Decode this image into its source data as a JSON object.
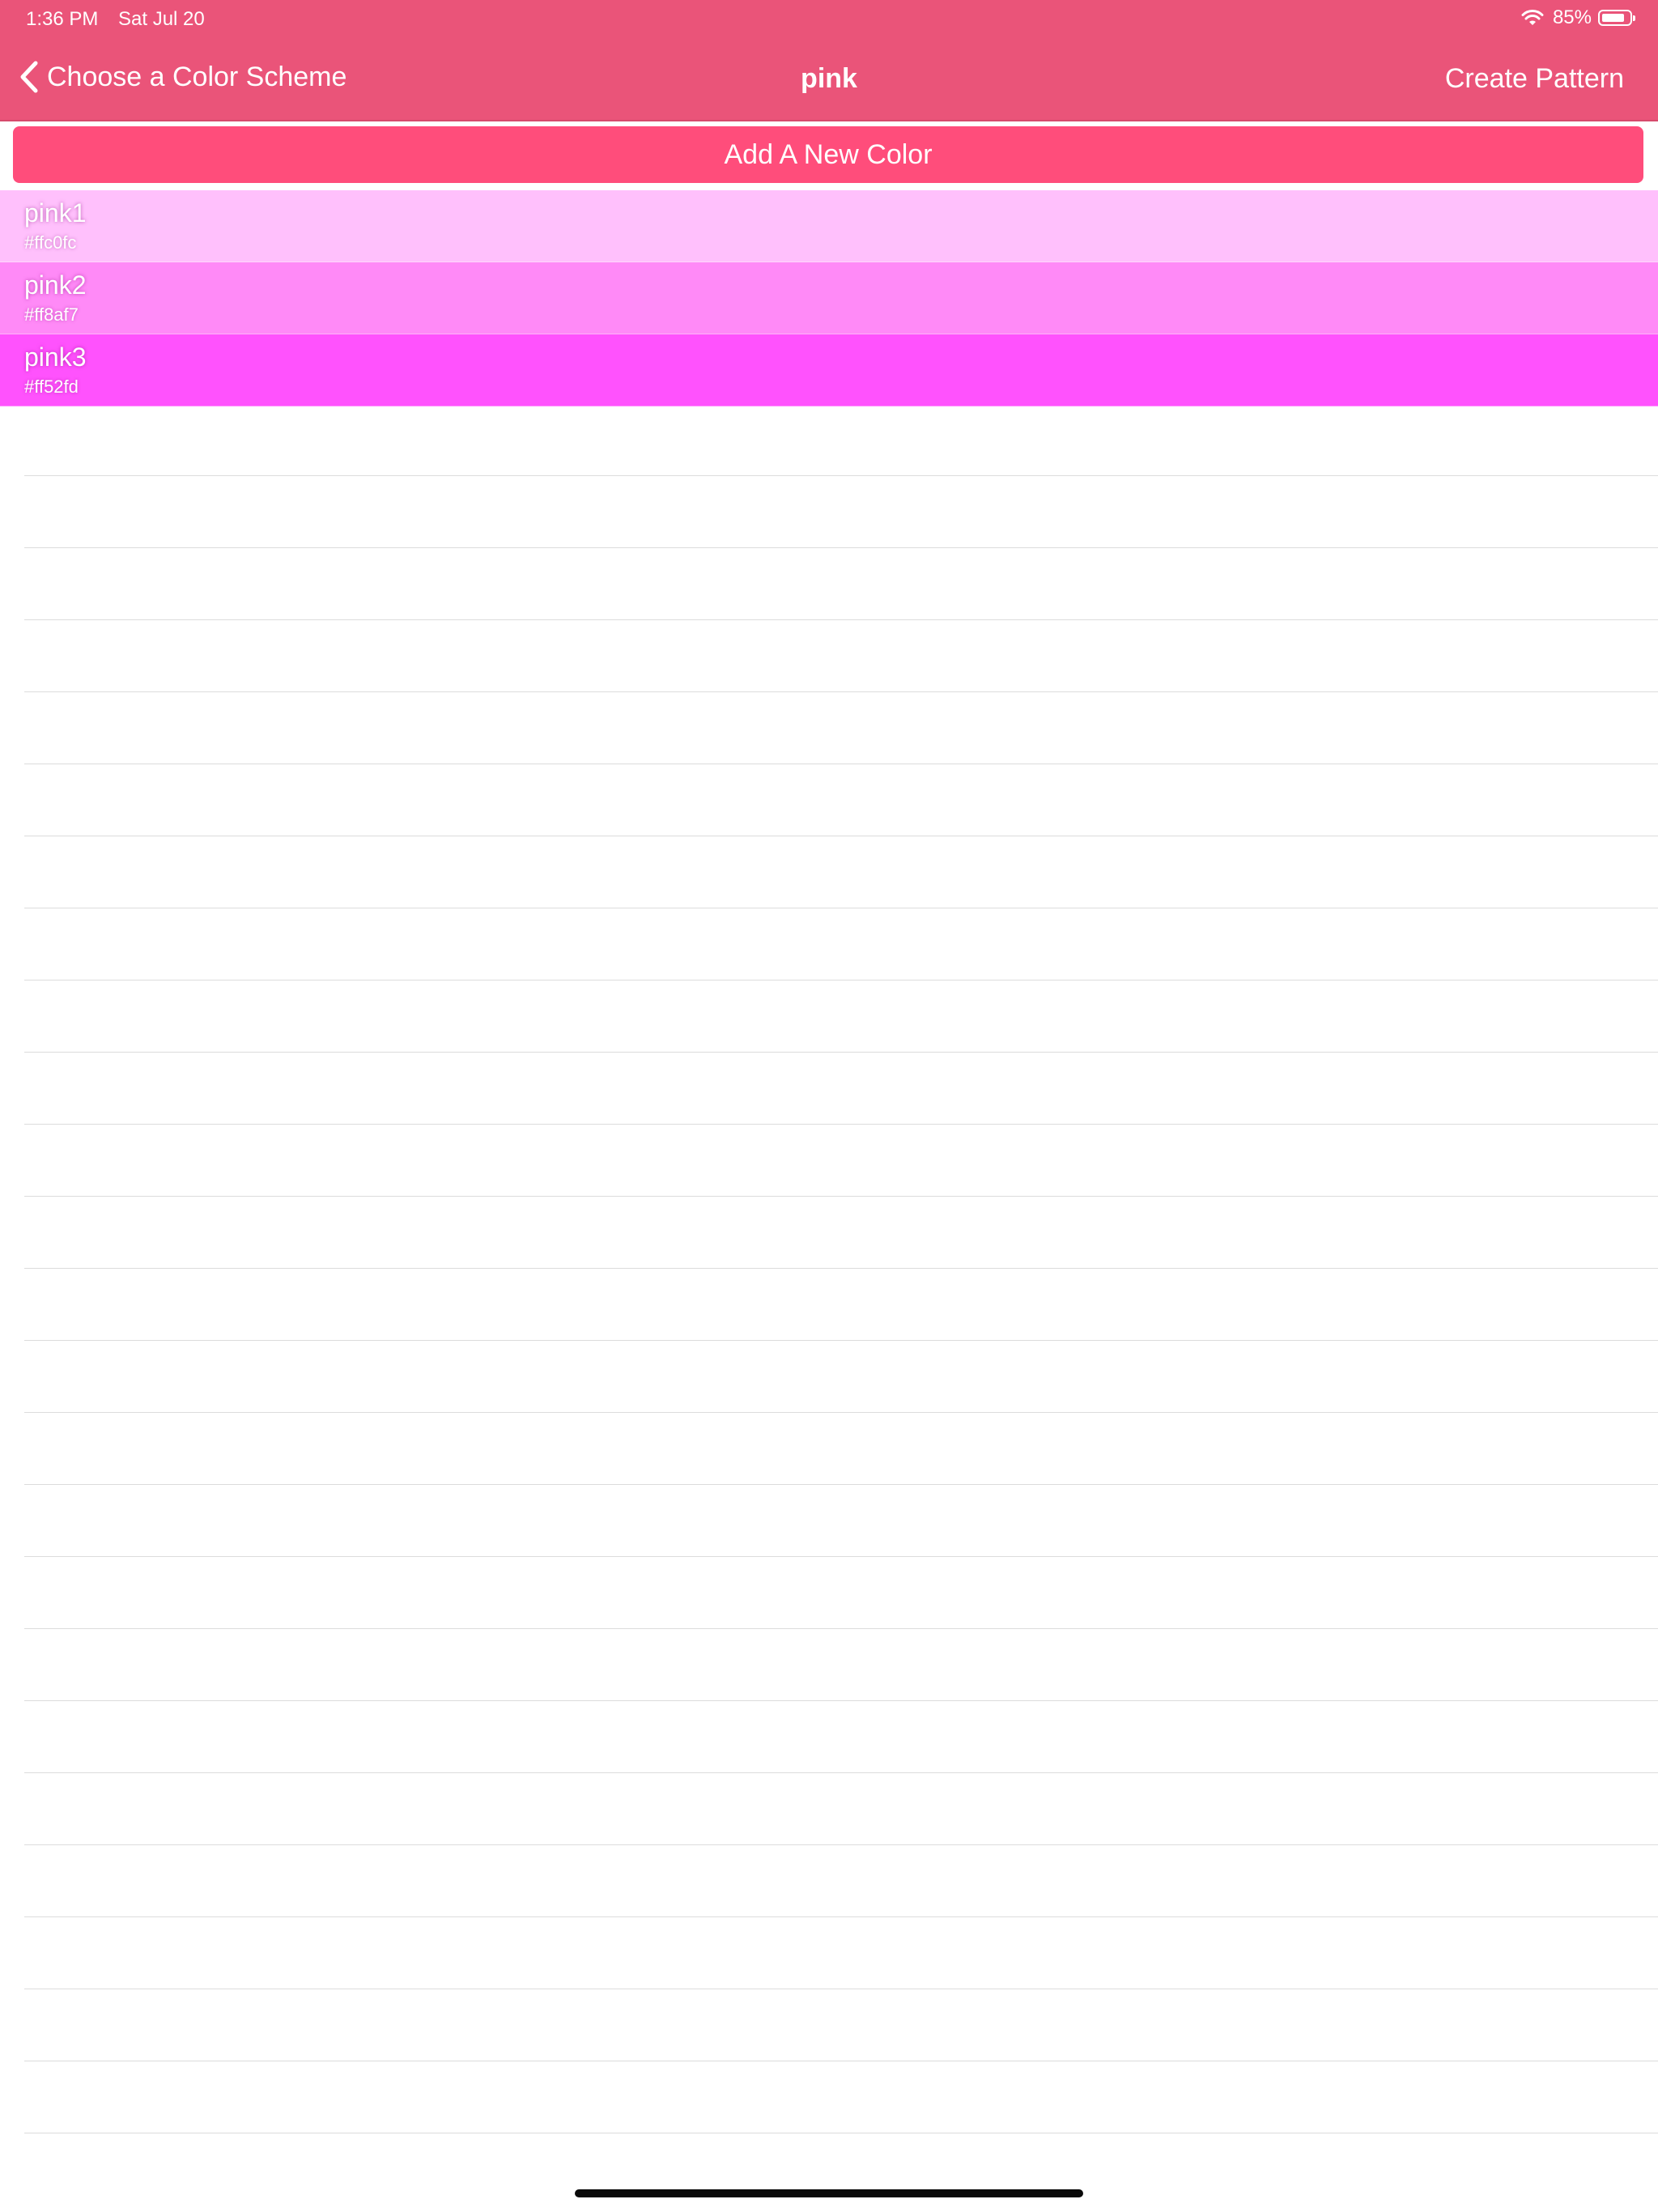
{
  "status_bar": {
    "time": "1:36 PM",
    "date": "Sat Jul 20",
    "battery_percent_label": "85%",
    "battery_level": 0.85
  },
  "nav": {
    "back_label": "Choose a Color Scheme",
    "title": "pink",
    "action_label": "Create Pattern"
  },
  "add_color_label": "Add A New Color",
  "colors": [
    {
      "name": "pink1",
      "hex": "#ffc0fc"
    },
    {
      "name": "pink2",
      "hex": "#ff8af7"
    },
    {
      "name": "pink3",
      "hex": "#ff52fd"
    }
  ],
  "theme": {
    "header_bg": "#ea5479",
    "button_bg": "#ff4d7b"
  }
}
